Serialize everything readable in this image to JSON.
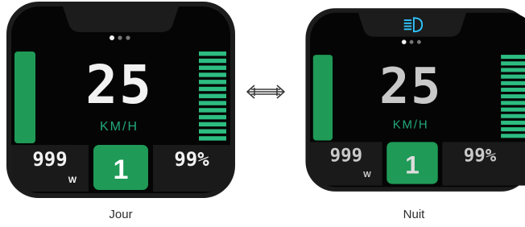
{
  "displays": [
    {
      "mode": "day",
      "speed": "25",
      "speed_unit": "KM/H",
      "power": "999",
      "power_unit": "W",
      "assist_level": "1",
      "battery": "99%",
      "page_dots": 3,
      "active_dot": 0,
      "headlight_on": false,
      "speed_bar_segments": 13,
      "caption": "Jour",
      "colors": {
        "frame": "#1c1c1c",
        "screen": "#050505",
        "digits": "#f2f2f2",
        "unit_text": "#22a87a",
        "green": "#1f9a57",
        "segments": "#2dbd82",
        "panel": "#1a1a1a"
      }
    },
    {
      "mode": "night",
      "speed": "25",
      "speed_unit": "KM/H",
      "power": "999",
      "power_unit": "W",
      "assist_level": "1",
      "battery": "99%",
      "page_dots": 3,
      "active_dot": 0,
      "headlight_on": true,
      "headlight_icon": "headlight-icon",
      "speed_bar_segments": 13,
      "caption": "Nuit",
      "colors": {
        "frame": "#1c1c1c",
        "screen": "#050505",
        "digits": "#c9c9c9",
        "unit_text": "#22a87a",
        "green": "#1f9a57",
        "segments": "#2dbd82",
        "panel": "#1a1a1a",
        "headlight": "#2ec6ff"
      }
    }
  ],
  "comparison_icon": "double-arrow-icon"
}
